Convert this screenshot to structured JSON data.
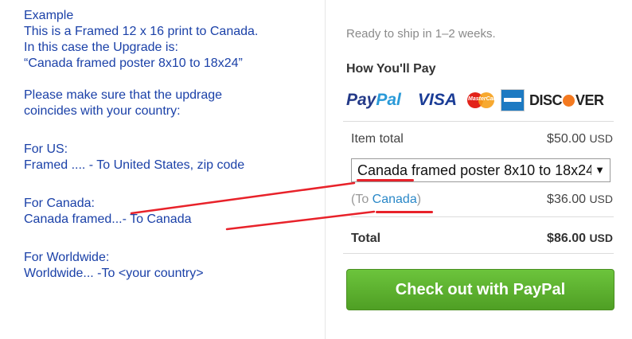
{
  "instructions": {
    "lines": [
      "Example",
      "This is a Framed 12 x 16 print to Canada.",
      "In this case the Upgrade is:",
      "“Canada framed poster 8x10 to 18x24”",
      "Please make sure that the updrage",
      "coincides with your country:",
      "For US:",
      "Framed .... - To United States, zip code",
      "For Canada:",
      "Canada framed...- To Canada",
      "For Worldwide:",
      "Worldwide... -To <your country>"
    ]
  },
  "checkout": {
    "shipping_note": "Ready to ship in 1–2 weeks.",
    "how_pay_title": "How You'll Pay",
    "payment_methods": {
      "paypal_a": "Pay",
      "paypal_b": "Pal",
      "visa": "VISA",
      "mastercard": "MasterCard",
      "discover_a": "DISC",
      "discover_b": "VER"
    },
    "item_total_label": "Item total",
    "item_total_value": "$50.00",
    "currency": "USD",
    "upgrade_select_value": "Canada framed poster 8x10 to 18x24",
    "shipping_prefix": "(To ",
    "shipping_country": "Canada",
    "shipping_suffix": ")",
    "shipping_value": "$36.00",
    "total_label": "Total",
    "total_value": "$86.00",
    "checkout_button": "Check out with PayPal"
  },
  "colors": {
    "note_text": "#1b41a8",
    "annotation": "#e8222a",
    "button": "#5fb22f"
  }
}
